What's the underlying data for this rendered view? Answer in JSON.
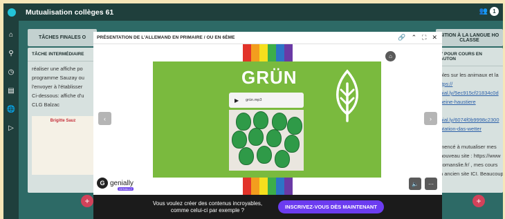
{
  "app": {
    "title": "Mutualisation collèges 61",
    "user_count": "1",
    "nav_icons": [
      "home-icon",
      "search-icon",
      "clock-icon",
      "message-icon",
      "globe-icon",
      "play-square-icon"
    ]
  },
  "board": {
    "left_column": {
      "header": "TÂCHES FINALES O",
      "card_title": "TÂCHE INTERMÉDIAIRE",
      "lines": [
        "réaliser une affiche po",
        "programme Sauzay ou",
        "l'envoyer à l'établisser",
        "Ci-dessous: affiche d'u",
        "CLG Balzac"
      ],
      "thumbnail_title": "Brigitte Sauz"
    },
    "right_column": {
      "header_line1": "SITION À LA LANGUE HO",
      "header_line2": "CLASSE",
      "card_title": "Y POUR COURS EN AUTON",
      "lines": [
        {
          "text": "oles sur les animaux et la",
          "link": false
        },
        {
          "text": "ttps://",
          "link": true
        },
        {
          "text": "nial.ly/5ec915cf21834c0d",
          "link": true
        },
        {
          "text": "heine-haustiere",
          "link": true
        },
        {
          "text": "",
          "link": false
        },
        {
          "text": "nial.ly/6074f0b9998c2300",
          "link": true
        },
        {
          "text": "ntation-das-wetter",
          "link": true
        },
        {
          "text": "",
          "link": false
        },
        {
          "text": "mencé à mutualiser mes",
          "link": false
        },
        {
          "text": "nouveau site : https://www",
          "link": false
        },
        {
          "text": "comanslie.fr/ , mes cours",
          "link": false
        },
        {
          "text": "n ancien site ICI. Beaucoup",
          "link": false
        }
      ]
    }
  },
  "modal": {
    "title": "PRÉSENTATION DE L'ALLEMAND EN PRIMAIRE / OU EN 6ÈME",
    "controls": [
      "link-icon",
      "chevron-up-icon",
      "fullscreen-icon",
      "close-icon"
    ],
    "slide": {
      "word": "GRÜN",
      "audio_file": "grün.mp3",
      "colors": {
        "slide_bg": "#7aba3e",
        "stripes": [
          "#e2332a",
          "#f39d1e",
          "#f6df1e",
          "#3cae4a",
          "#2d74c6",
          "#6a3aa5"
        ]
      }
    },
    "brand": {
      "name": "genially",
      "tag": "GENIALLY"
    },
    "cta": {
      "text_line1": "Vous voulez créer des contenus incroyables,",
      "text_line2": "comme celui-ci par exemple ?",
      "button": "INSCRIVEZ-VOUS DÈS MAINTENANT"
    }
  }
}
